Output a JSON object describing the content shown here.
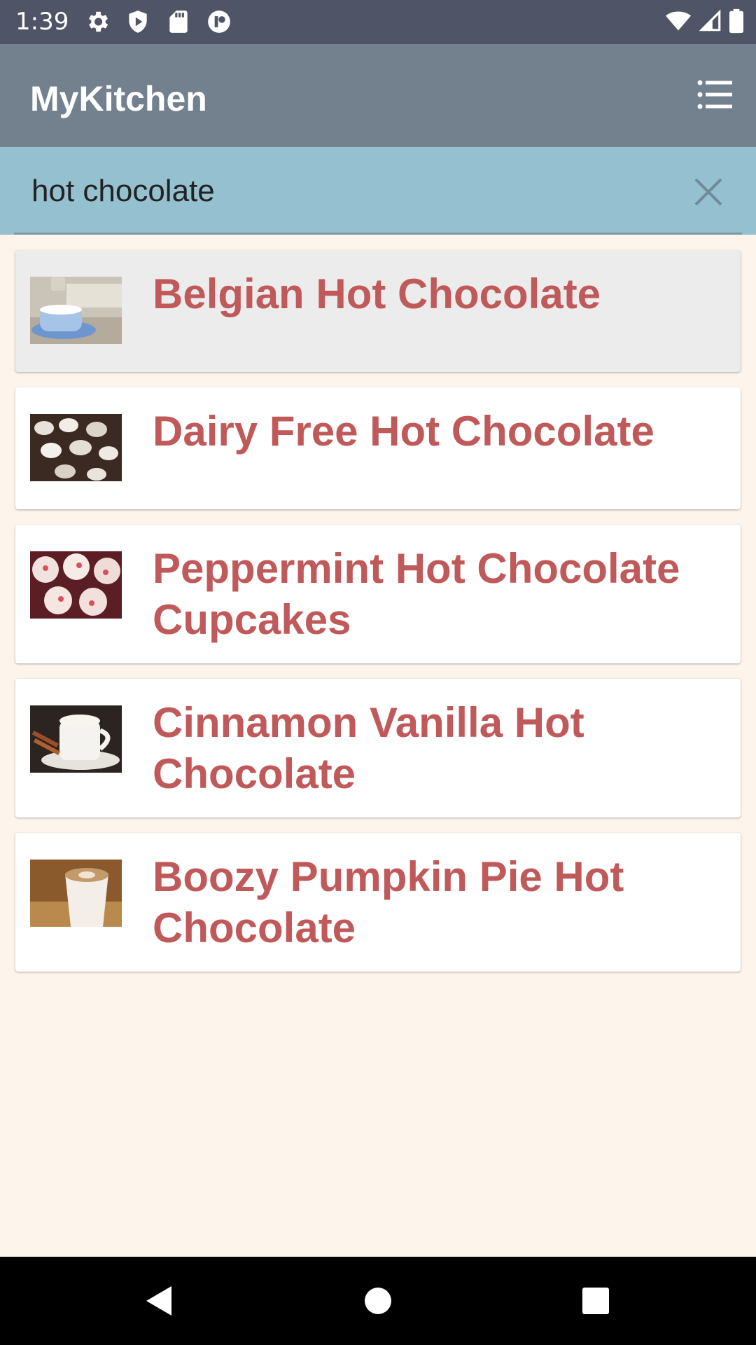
{
  "status_bar": {
    "time": "1:39",
    "left_icons": [
      "settings-icon",
      "shield-play-icon",
      "sd-card-icon",
      "app-badge-icon"
    ],
    "right_icons": [
      "wifi-icon",
      "signal-icon",
      "battery-icon"
    ]
  },
  "app_bar": {
    "title": "MyKitchen",
    "menu_icon": "list-menu-icon",
    "color": "#73808e"
  },
  "search": {
    "value": "hot chocolate",
    "clear_icon": "close-icon",
    "color": "#94c0cf"
  },
  "results": [
    {
      "title": "Belgian Hot Chocolate",
      "thumb_icon": "thumb-belgian-hot-chocolate",
      "selected": true
    },
    {
      "title": "Dairy Free Hot Chocolate",
      "thumb_icon": "thumb-dairy-free-hot-chocolate",
      "selected": false
    },
    {
      "title": "Peppermint Hot Chocolate Cupcakes",
      "thumb_icon": "thumb-peppermint-cupcakes",
      "selected": false
    },
    {
      "title": "Cinnamon Vanilla Hot Chocolate",
      "thumb_icon": "thumb-cinnamon-vanilla",
      "selected": false
    },
    {
      "title": "Boozy Pumpkin Pie Hot Chocolate",
      "thumb_icon": "thumb-boozy-pumpkin-pie",
      "selected": false
    }
  ],
  "colors": {
    "title_text": "#c0595a",
    "page_background": "#fdf5ec",
    "selected_card": "#ececec"
  },
  "nav_bar": {
    "buttons": [
      "back-icon",
      "home-icon",
      "recents-icon"
    ]
  }
}
